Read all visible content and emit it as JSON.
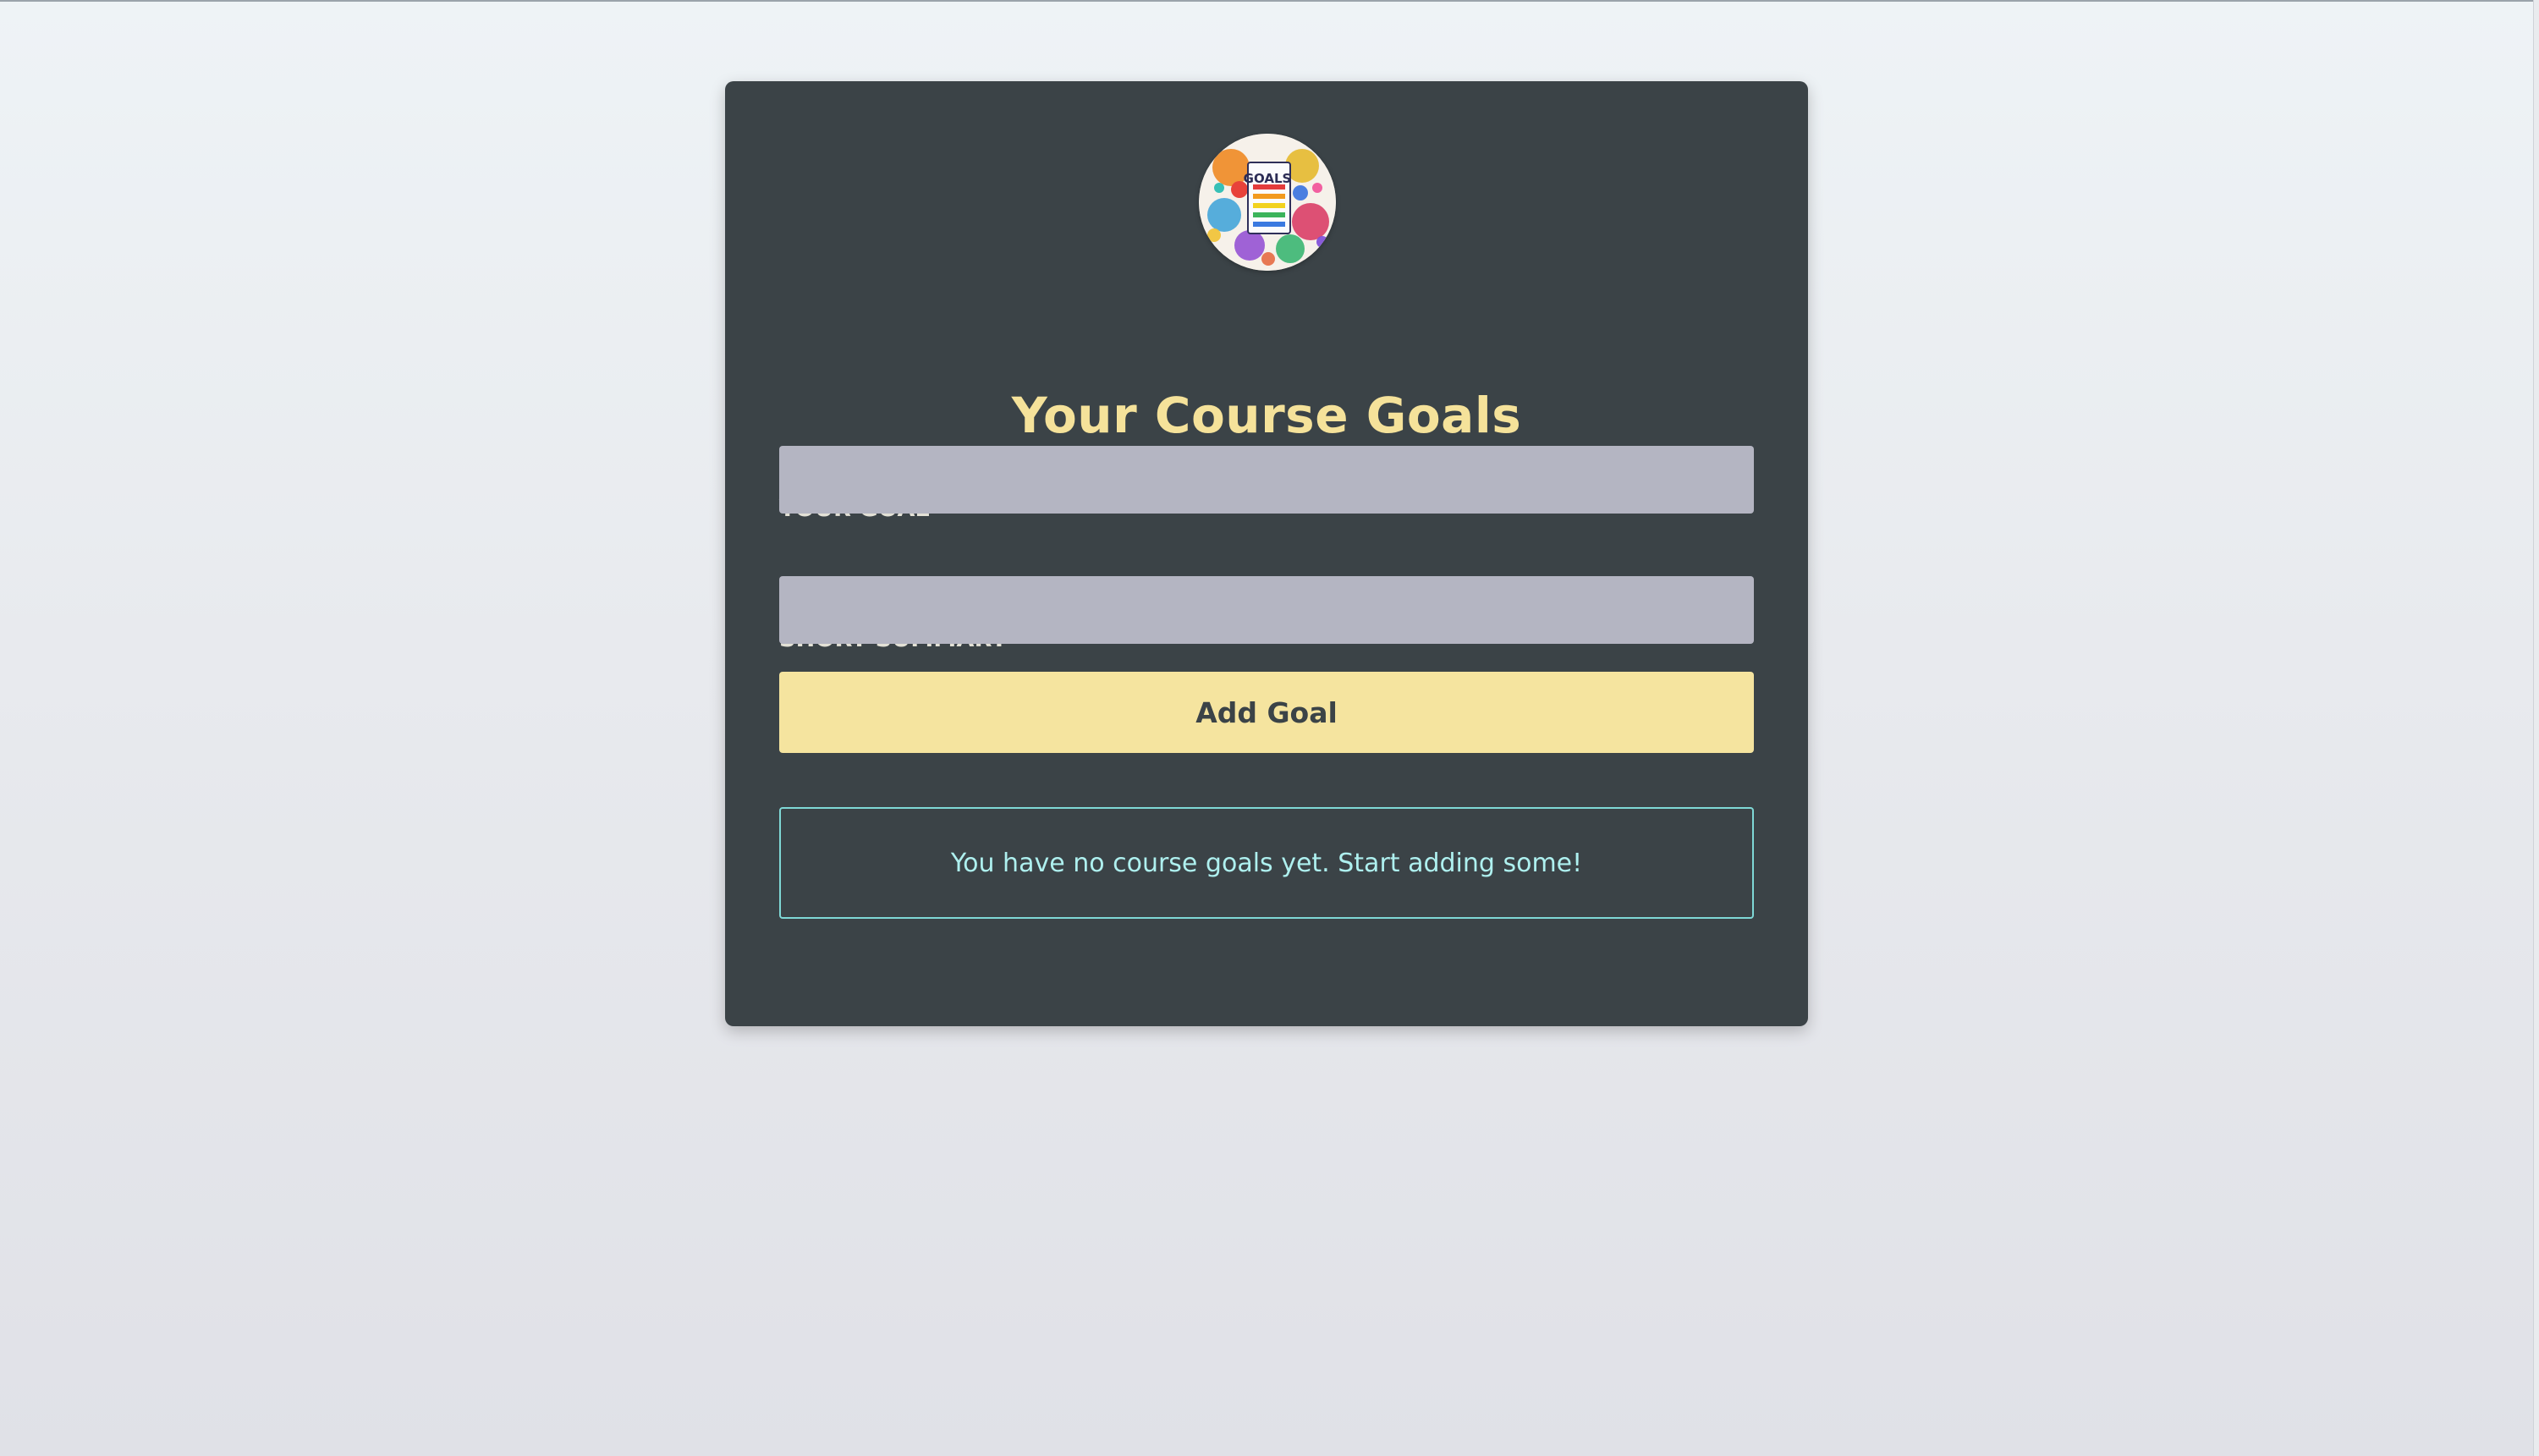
{
  "page": {
    "background_top": "#eef3f6",
    "background_bottom": "#e0e1e7"
  },
  "card": {
    "background": "#3b4347",
    "logo": {
      "icon": "goals-logo-icon",
      "text": "GOALS"
    },
    "title": "Your Course Goals",
    "title_color": "#f5e29a",
    "form": {
      "goal_label": "YOUR GOAL",
      "goal_value": "",
      "summary_label": "SHORT SUMMARY",
      "summary_value": "",
      "input_background": "#b4b5c2",
      "submit_label": "Add Goal",
      "submit_color": "#f5e49f"
    },
    "empty_state": {
      "message": "You have no course goals yet. Start adding some!",
      "border_color": "#7fd8d6",
      "text_color": "#aef0ef"
    }
  }
}
